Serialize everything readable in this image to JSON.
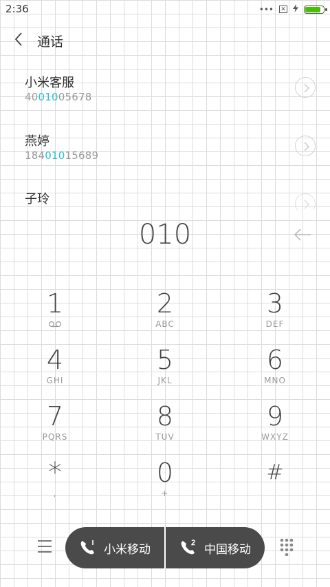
{
  "status": {
    "time": "2:36",
    "dots": "•••",
    "sim_icon": "sim-x-icon",
    "charging_icon": "bolt-icon",
    "battery_color": "#46c000"
  },
  "header": {
    "title": "通话"
  },
  "results": [
    {
      "name": "小米客服",
      "number_pre": "40",
      "number_match": "010",
      "number_post": "05678"
    },
    {
      "name": "燕婷",
      "number_pre": "184",
      "number_match": "010",
      "number_post": "15689"
    },
    {
      "name": "子玲",
      "number_pre": "",
      "number_match": "",
      "number_post": ""
    }
  ],
  "dialed": "010",
  "keypad": [
    {
      "digit": "1",
      "letters": ""
    },
    {
      "digit": "2",
      "letters": "ABC"
    },
    {
      "digit": "3",
      "letters": "DEF"
    },
    {
      "digit": "4",
      "letters": "GHI"
    },
    {
      "digit": "5",
      "letters": "JKL"
    },
    {
      "digit": "6",
      "letters": "MNO"
    },
    {
      "digit": "7",
      "letters": "PQRS"
    },
    {
      "digit": "8",
      "letters": "TUV"
    },
    {
      "digit": "9",
      "letters": "WXYZ"
    },
    {
      "digit": "*",
      "letters": ","
    },
    {
      "digit": "0",
      "letters": "+"
    },
    {
      "digit": "#",
      "letters": ""
    }
  ],
  "call": {
    "sim1_label": "小米移动",
    "sim2_label": "中国移动",
    "bar_color": "#4a4a4a",
    "highlight_color": "#2ac2d0"
  }
}
